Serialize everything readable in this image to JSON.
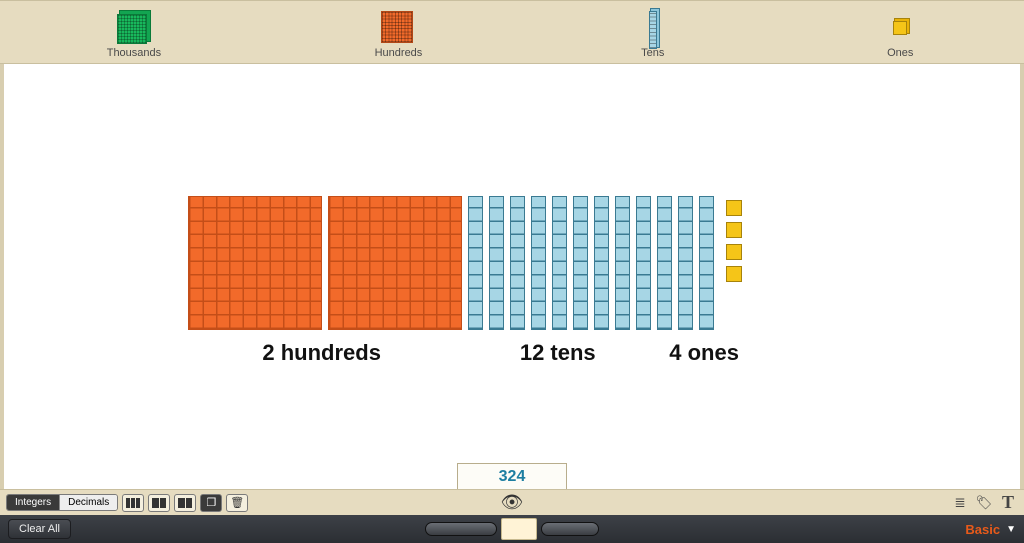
{
  "palette": {
    "thousands": "Thousands",
    "hundreds": "Hundreds",
    "tens": "Tens",
    "ones": "Ones"
  },
  "model": {
    "hundreds_count": 2,
    "tens_count": 12,
    "ones_count": 4,
    "hundreds_label": "2 hundreds",
    "tens_label": "12 tens",
    "ones_label": "4 ones",
    "total": "324"
  },
  "toolbar": {
    "mode_integers": "Integers",
    "mode_decimals": "Decimals",
    "clear_all": "Clear All",
    "menu_label": "Basic",
    "text_tool": "T"
  }
}
